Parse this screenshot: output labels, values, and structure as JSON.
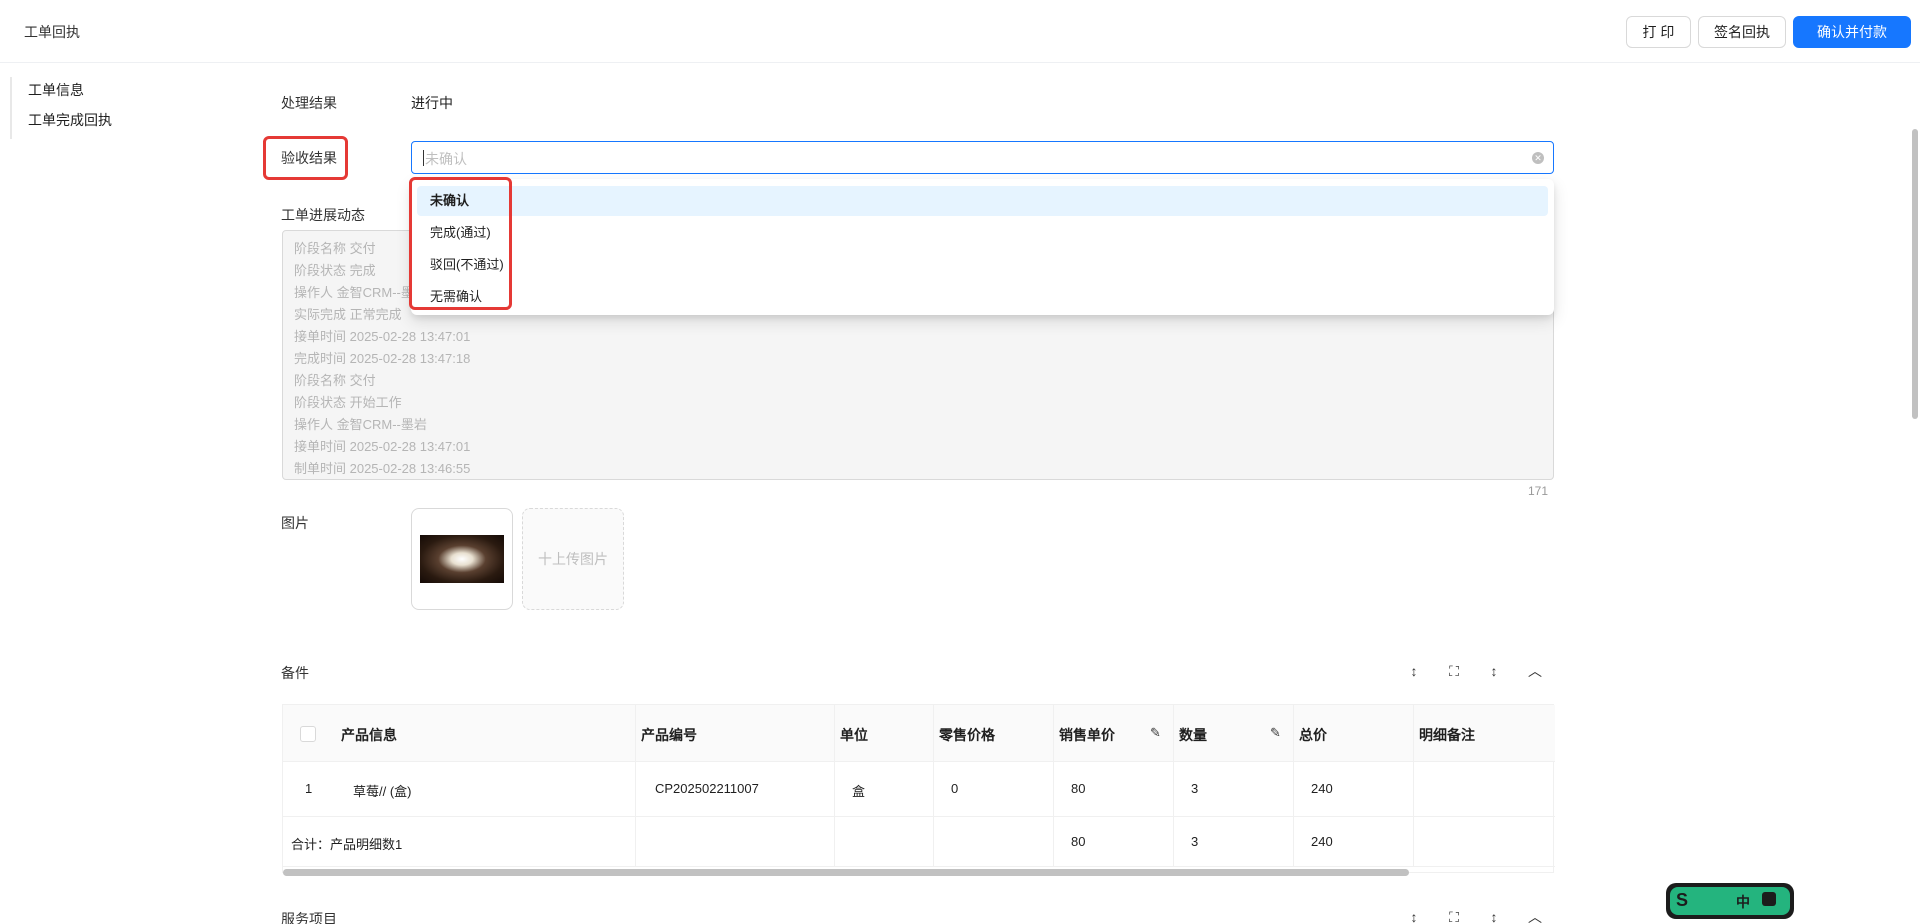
{
  "header": {
    "title": "工单回执",
    "print_label": "打 印",
    "sign_label": "签名回执",
    "confirm_label": "确认并付款"
  },
  "sidebar": {
    "items": [
      {
        "label": "工单信息"
      },
      {
        "label": "工单完成回执"
      }
    ]
  },
  "form": {
    "result_label": "处理结果",
    "result_value": "进行中",
    "acceptance_label": "验收结果",
    "acceptance_placeholder": "未确认",
    "progress_label": "工单进展动态",
    "image_label": "图片",
    "upload_label": "十上传图片",
    "progress_lines": [
      "阶段名称 交付",
      "阶段状态 完成",
      "操作人 金智CRM--墨岩",
      "实际完成 正常完成",
      "接单时间 2025-02-28 13:47:01",
      "完成时间 2025-02-28 13:47:18",
      "阶段名称 交付",
      "阶段状态 开始工作",
      "操作人 金智CRM--墨岩",
      "接单时间 2025-02-28 13:47:01",
      "制单时间 2025-02-28 13:46:55"
    ],
    "char_count": "171"
  },
  "dropdown": {
    "options": [
      "未确认",
      "完成(通过)",
      "驳回(不通过)",
      "无需确认"
    ],
    "selected": "未确认"
  },
  "parts": {
    "title": "备件",
    "columns": [
      "产品信息",
      "产品编号",
      "单位",
      "零售价格",
      "销售单价",
      "数量",
      "总价",
      "明细备注"
    ],
    "rows": [
      {
        "index": "1",
        "product": "草莓// (盒)",
        "code": "CP202502211007",
        "unit": "盒",
        "retail": "0",
        "price": "80",
        "qty": "3",
        "total": "240",
        "note": ""
      }
    ],
    "summary": {
      "label": "合计：产品明细数1",
      "price": "80",
      "qty": "3",
      "total": "240"
    }
  },
  "services": {
    "title": "服务项目"
  },
  "widget": {
    "lang": "中"
  },
  "colors": {
    "primary": "#1677ff",
    "highlight_border": "#e53935",
    "selected_option_bg": "#e6f4ff"
  }
}
